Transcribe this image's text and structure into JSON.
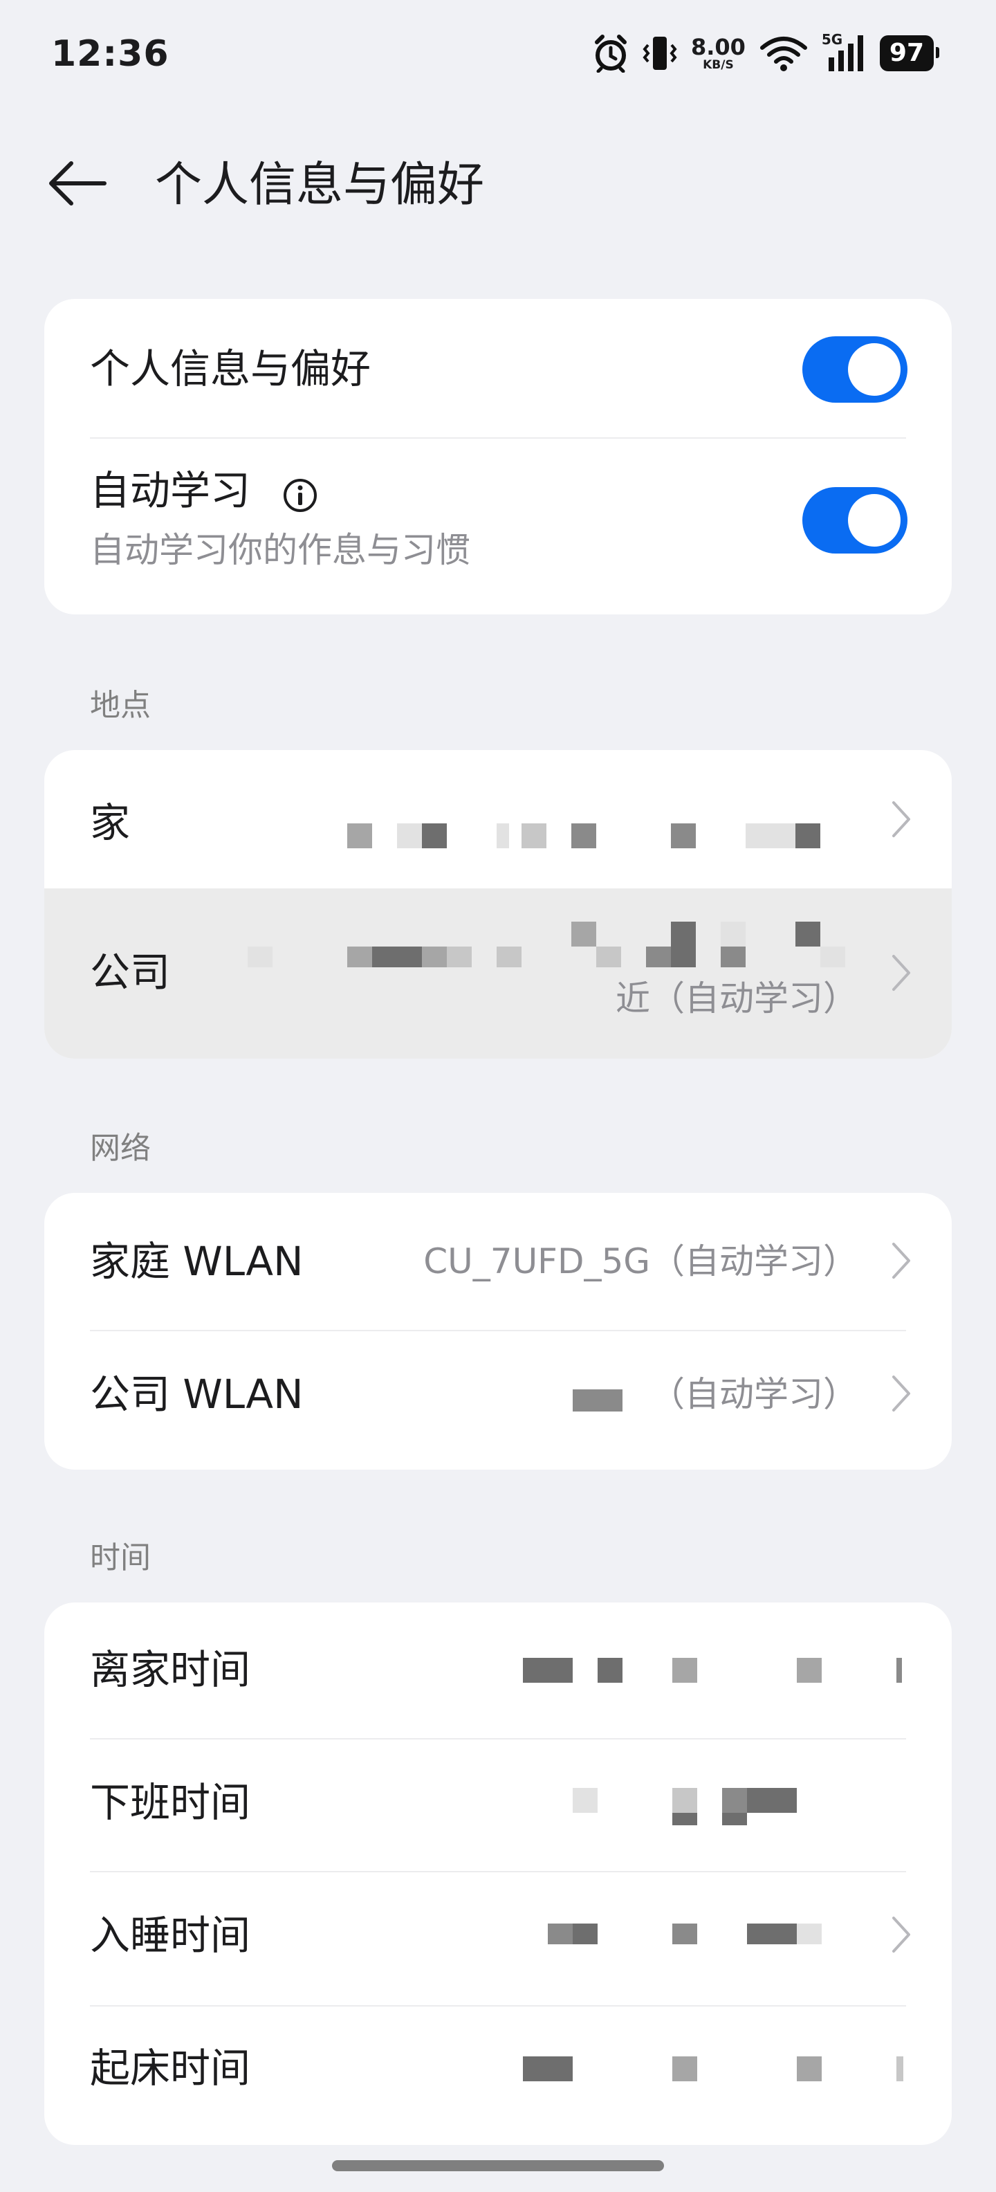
{
  "status_bar": {
    "time": "12:36",
    "net_speed_value": "8.00",
    "net_speed_unit": "KB/S",
    "network_type": "5G",
    "battery": "97"
  },
  "header": {
    "title": "个人信息与偏好"
  },
  "settings_card": {
    "personal_info_label": "个人信息与偏好",
    "personal_info_enabled": true,
    "auto_learn_label": "自动学习",
    "auto_learn_desc": "自动学习你的作息与习惯",
    "auto_learn_enabled": true
  },
  "location": {
    "section_title": "地点",
    "home_label": "家",
    "office_label": "公司",
    "office_value_suffix": "近（自动学习）"
  },
  "network": {
    "section_title": "网络",
    "home_wlan_label": "家庭 WLAN",
    "home_wlan_value": "CU_7UFD_5G（自动学习）",
    "office_wlan_label": "公司 WLAN",
    "office_wlan_value": "（自动学习）"
  },
  "time": {
    "section_title": "时间",
    "leave_home_label": "离家时间",
    "off_work_label": "下班时间",
    "sleep_label": "入睡时间",
    "wake_label": "起床时间"
  },
  "colors": {
    "accent": "#0a6cf2",
    "background": "#f0f1f5",
    "secondary_text": "#8e8e93"
  }
}
